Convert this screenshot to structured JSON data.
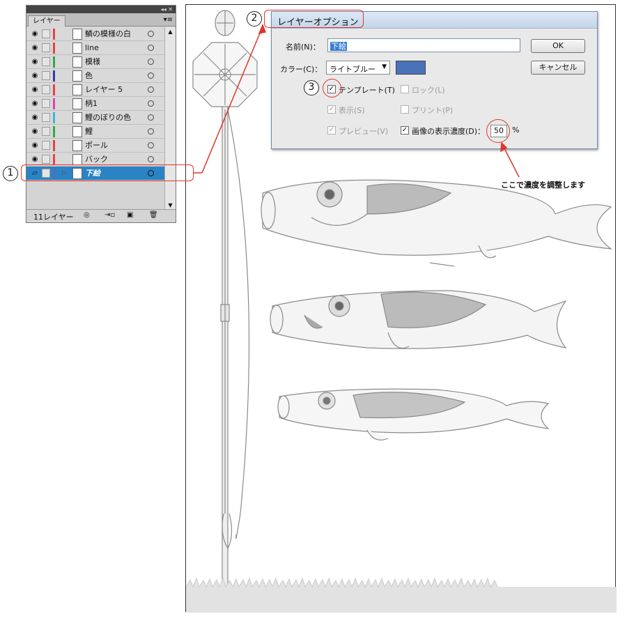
{
  "layers_panel": {
    "topbar_controls": "◂◂ ✕",
    "tab_label": "レイヤー",
    "menu_icon": "▾≡",
    "layers": [
      {
        "name": "鱗の模様の白",
        "color": "#e8404a",
        "selected": false,
        "icon": "eye-icon"
      },
      {
        "name": "line",
        "color": "#e8404a",
        "selected": false,
        "icon": "eye-icon"
      },
      {
        "name": "模様",
        "color": "#2ea84a",
        "selected": false,
        "icon": "eye-icon"
      },
      {
        "name": "色",
        "color": "#3a3aa8",
        "selected": false,
        "icon": "eye-icon"
      },
      {
        "name": "レイヤー 5",
        "color": "#e8404a",
        "selected": false,
        "icon": "eye-icon"
      },
      {
        "name": "柄1",
        "color": "#e040b0",
        "selected": false,
        "icon": "eye-icon"
      },
      {
        "name": "鯉のぼりの色",
        "color": "#3ab8d8",
        "selected": false,
        "icon": "eye-icon"
      },
      {
        "name": "鯉",
        "color": "#2ea84a",
        "selected": false,
        "icon": "eye-icon"
      },
      {
        "name": "ポール",
        "color": "#e8404a",
        "selected": false,
        "icon": "eye-icon"
      },
      {
        "name": "バック",
        "color": "#e8404a",
        "selected": false,
        "icon": "eye-icon"
      },
      {
        "name": "下絵",
        "color": "#5a6ab8",
        "selected": true,
        "icon": "template-icon"
      }
    ],
    "layer_count": "11レイヤー",
    "footer_icons": [
      "make-clipping-mask-icon",
      "new-sublayer-icon",
      "new-layer-icon",
      "delete-layer-icon"
    ]
  },
  "callouts": {
    "one": "1",
    "two": "2",
    "three": "3"
  },
  "dialog": {
    "title": "レイヤーオプション",
    "name_label": "名前(N)：",
    "name_value": "下絵",
    "color_label": "カラー(C)：",
    "color_value": "ライトブルー",
    "swatch_color": "#4a72b8",
    "ok_label": "OK",
    "cancel_label": "キャンセル",
    "checkboxes": {
      "template": {
        "label": "テンプレート(T)",
        "checked": true,
        "enabled": true
      },
      "lock": {
        "label": "ロック(L)",
        "checked": false,
        "enabled": false
      },
      "show": {
        "label": "表示(S)",
        "checked": true,
        "enabled": false
      },
      "print": {
        "label": "プリント(P)",
        "checked": false,
        "enabled": false
      },
      "preview": {
        "label": "プレビュー(V)",
        "checked": true,
        "enabled": false
      },
      "dim_images": {
        "label": "画像の表示濃度(D)：",
        "checked": true,
        "enabled": true
      }
    },
    "dim_value": "50",
    "dim_unit": "%"
  },
  "annotation_text": "ここで濃度を調整します",
  "accent_color": "#e0342b",
  "selection_color": "#2a83c4"
}
